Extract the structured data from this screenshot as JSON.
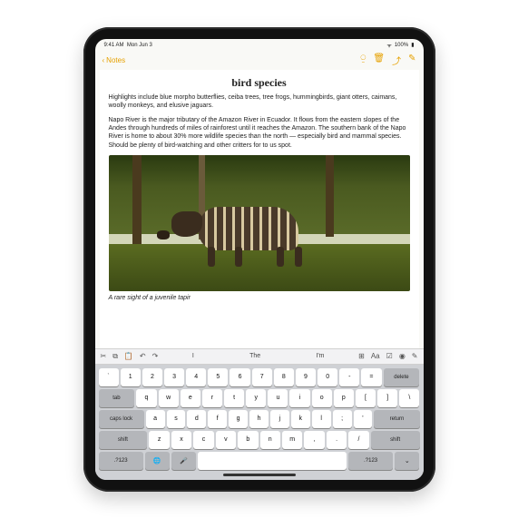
{
  "status": {
    "time": "9:41 AM",
    "day": "Mon Jun 3",
    "wifi": "wifi",
    "battery": "100%"
  },
  "nav": {
    "back": "Notes",
    "icons": {
      "people": "people-icon",
      "trash": "trash-icon",
      "share": "share-icon",
      "compose": "compose-icon"
    }
  },
  "note": {
    "title": "bird species",
    "p1": "Highlights include blue morpho butterflies, ceiba trees, tree frogs, hummingbirds, giant otters, caimans, woolly monkeys, and elusive jaguars.",
    "p2": "Napo River is the major tributary of the Amazon River in Ecuador. It flows from the eastern slopes of the Andes through hundreds of miles of rainforest until it reaches the Amazon. The southern bank of the Napo River is home to about 30% more wildlife species than the north — especially bird and mammal species. Should be plenty of bird-watching and other critters for to us spot.",
    "caption": "A rare sight of a juvenile tapir"
  },
  "toolbar": {
    "cut": "✂",
    "copy": "⧉",
    "paste": "📋",
    "undo": "↶",
    "redo": "↷",
    "suggestions": [
      "I",
      "The",
      "I'm"
    ],
    "table": "⊞",
    "format": "Aa",
    "checklist": "☑",
    "camera": "◉",
    "pencil": "✎"
  },
  "keyboard": {
    "row0": [
      "`",
      "1",
      "2",
      "3",
      "4",
      "5",
      "6",
      "7",
      "8",
      "9",
      "0",
      "-",
      "=",
      "delete"
    ],
    "row1": [
      "tab",
      "q",
      "w",
      "e",
      "r",
      "t",
      "y",
      "u",
      "i",
      "o",
      "p",
      "[",
      "]",
      "\\"
    ],
    "row2": [
      "caps lock",
      "a",
      "s",
      "d",
      "f",
      "g",
      "h",
      "j",
      "k",
      "l",
      ";",
      "'",
      "return"
    ],
    "row3": [
      "shift",
      "z",
      "x",
      "c",
      "v",
      "b",
      "n",
      "m",
      ",",
      ".",
      "/",
      "shift"
    ],
    "row4": [
      ".?123",
      "🌐",
      "🎤",
      " ",
      ".?123",
      "⌄"
    ]
  }
}
